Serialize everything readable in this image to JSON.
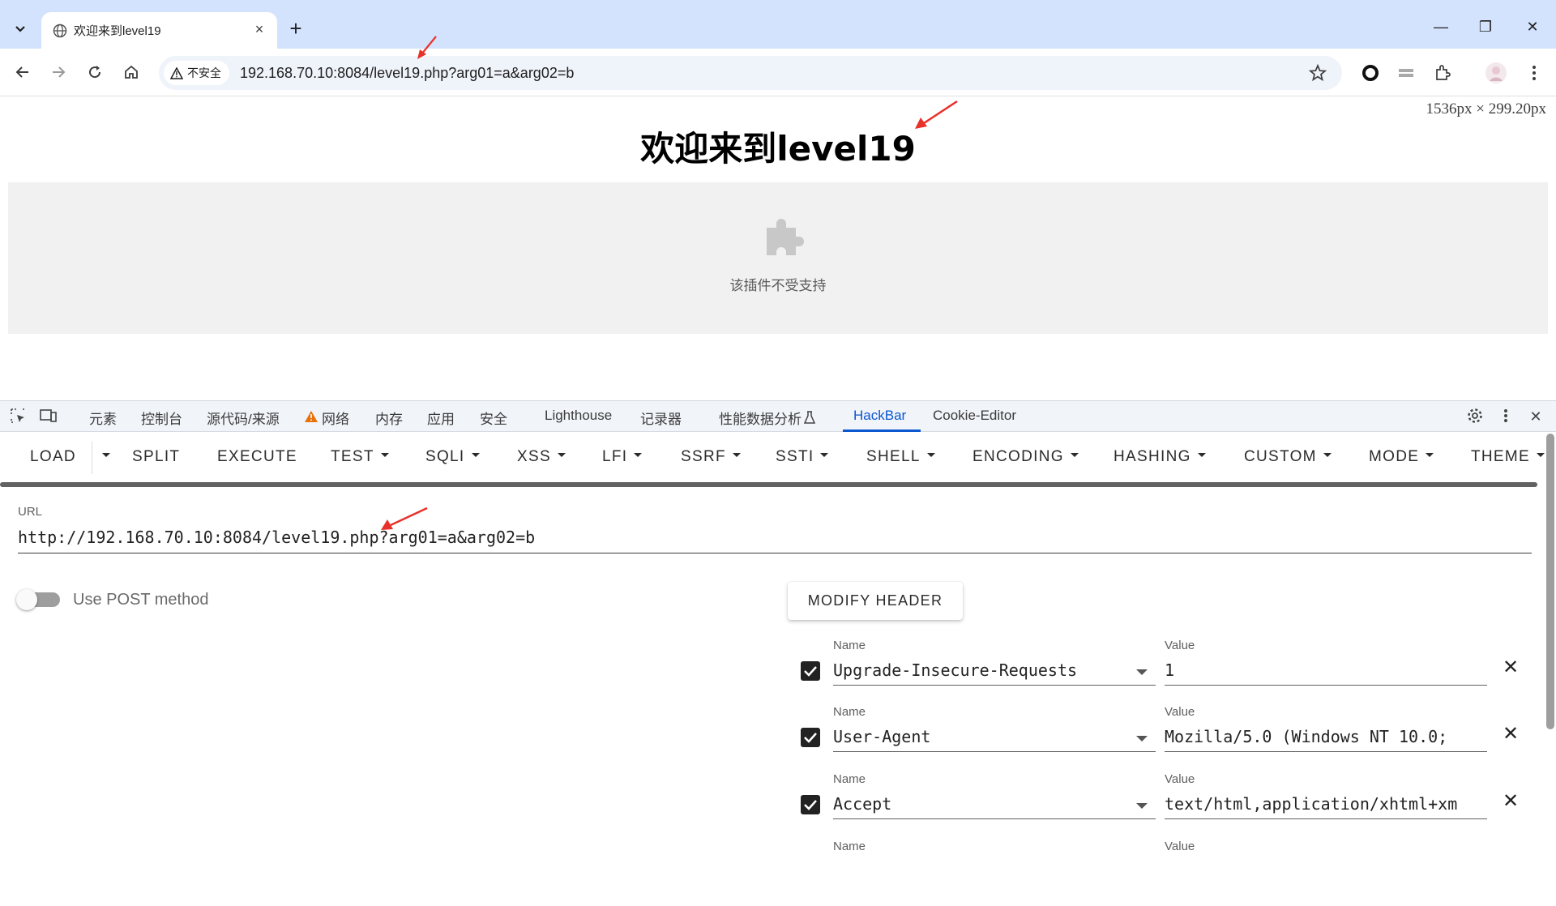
{
  "browser": {
    "tab_title": "欢迎来到level19",
    "tab_close": "×",
    "new_tab": "+",
    "win_minimize": "—",
    "win_restore": "❐",
    "win_close": "✕",
    "security_label": "不安全",
    "url": "192.168.70.10:8084/level19.php?arg01=a&arg02=b"
  },
  "page": {
    "dimensions": "1536px × 299.20px",
    "heading": "欢迎来到level19",
    "plugin_message": "该插件不受支持"
  },
  "devtools": {
    "tabs": [
      "元素",
      "控制台",
      "源代码/来源",
      "网络",
      "内存",
      "应用",
      "安全",
      "Lighthouse",
      "记录器",
      "性能数据分析",
      "HackBar",
      "Cookie-Editor"
    ],
    "active_tab": "HackBar",
    "close": "✕"
  },
  "hackbar": {
    "menu": [
      "LOAD",
      "SPLIT",
      "EXECUTE",
      "TEST",
      "SQLI",
      "XSS",
      "LFI",
      "SSRF",
      "SSTI",
      "SHELL",
      "ENCODING",
      "HASHING",
      "CUSTOM",
      "MODE",
      "THEME"
    ],
    "url_label": "URL",
    "url_value": "http://192.168.70.10:8084/level19.php?arg01=a&arg02=b",
    "post_label": "Use POST method",
    "post_enabled": false,
    "modify_header_label": "MODIFY HEADER",
    "name_label": "Name",
    "value_label": "Value",
    "delete_glyph": "✕",
    "headers": [
      {
        "name": "Upgrade-Insecure-Requests",
        "value": "1",
        "checked": true
      },
      {
        "name": "User-Agent",
        "value": "Mozilla/5.0 (Windows NT 10.0;",
        "checked": true
      },
      {
        "name": "Accept",
        "value": "text/html,application/xhtml+xm",
        "checked": true
      }
    ]
  },
  "colors": {
    "tabstrip_bg": "#d3e3fd",
    "accent": "#0b57d0",
    "annotation_arrow": "#e8312a",
    "warning": "#e8710a"
  },
  "icons": [
    "tab-search-icon",
    "globe-icon",
    "back-icon",
    "forward-icon",
    "reload-icon",
    "home-icon",
    "warning-icon",
    "star-icon",
    "extension-icon",
    "avatar-icon",
    "menu-icon",
    "puzzle-icon",
    "gear-icon",
    "inspect-icon",
    "device-icon",
    "checkbox-icon",
    "delete-icon",
    "arrow-annotation"
  ]
}
